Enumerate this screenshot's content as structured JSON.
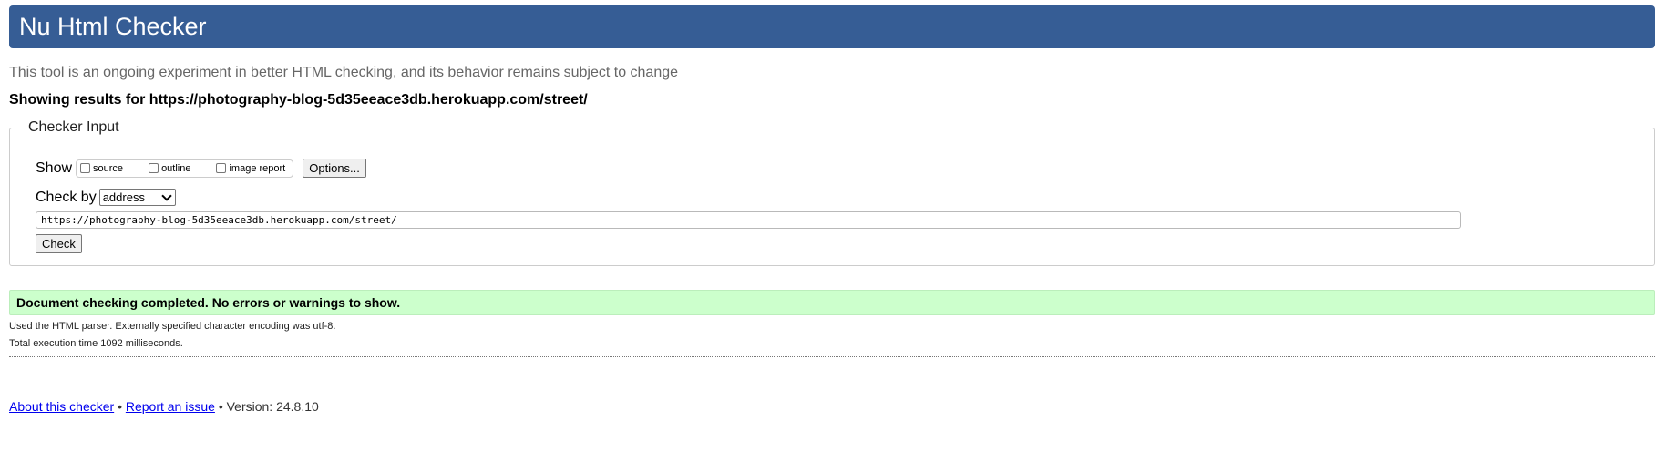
{
  "header": {
    "title": "Nu Html Checker"
  },
  "intro": "This tool is an ongoing experiment in better HTML checking, and its behavior remains subject to change",
  "results_line": "Showing results for https://photography-blog-5d35eeace3db.herokuapp.com/street/",
  "checker_input": {
    "legend": "Checker Input",
    "show_label": "Show",
    "show_options": [
      {
        "label": "source",
        "checked": false
      },
      {
        "label": "outline",
        "checked": false
      },
      {
        "label": "image report",
        "checked": false
      }
    ],
    "options_button": "Options...",
    "check_by_label": "Check by",
    "check_by_selected": "address",
    "url_value": "https://photography-blog-5d35eeace3db.herokuapp.com/street/",
    "check_button": "Check"
  },
  "result": {
    "message": "Document checking completed. No errors or warnings to show.",
    "parser_info": "Used the HTML parser. Externally specified character encoding was utf-8.",
    "execution_time": "Total execution time 1092 milliseconds."
  },
  "footer": {
    "about_link": "About this checker",
    "separator": "•",
    "report_link": "Report an issue",
    "version_text": "Version: 24.8.10"
  },
  "colors": {
    "header_bg": "#365d95",
    "success_bg": "#ccffcc",
    "link": "#0000ee"
  }
}
